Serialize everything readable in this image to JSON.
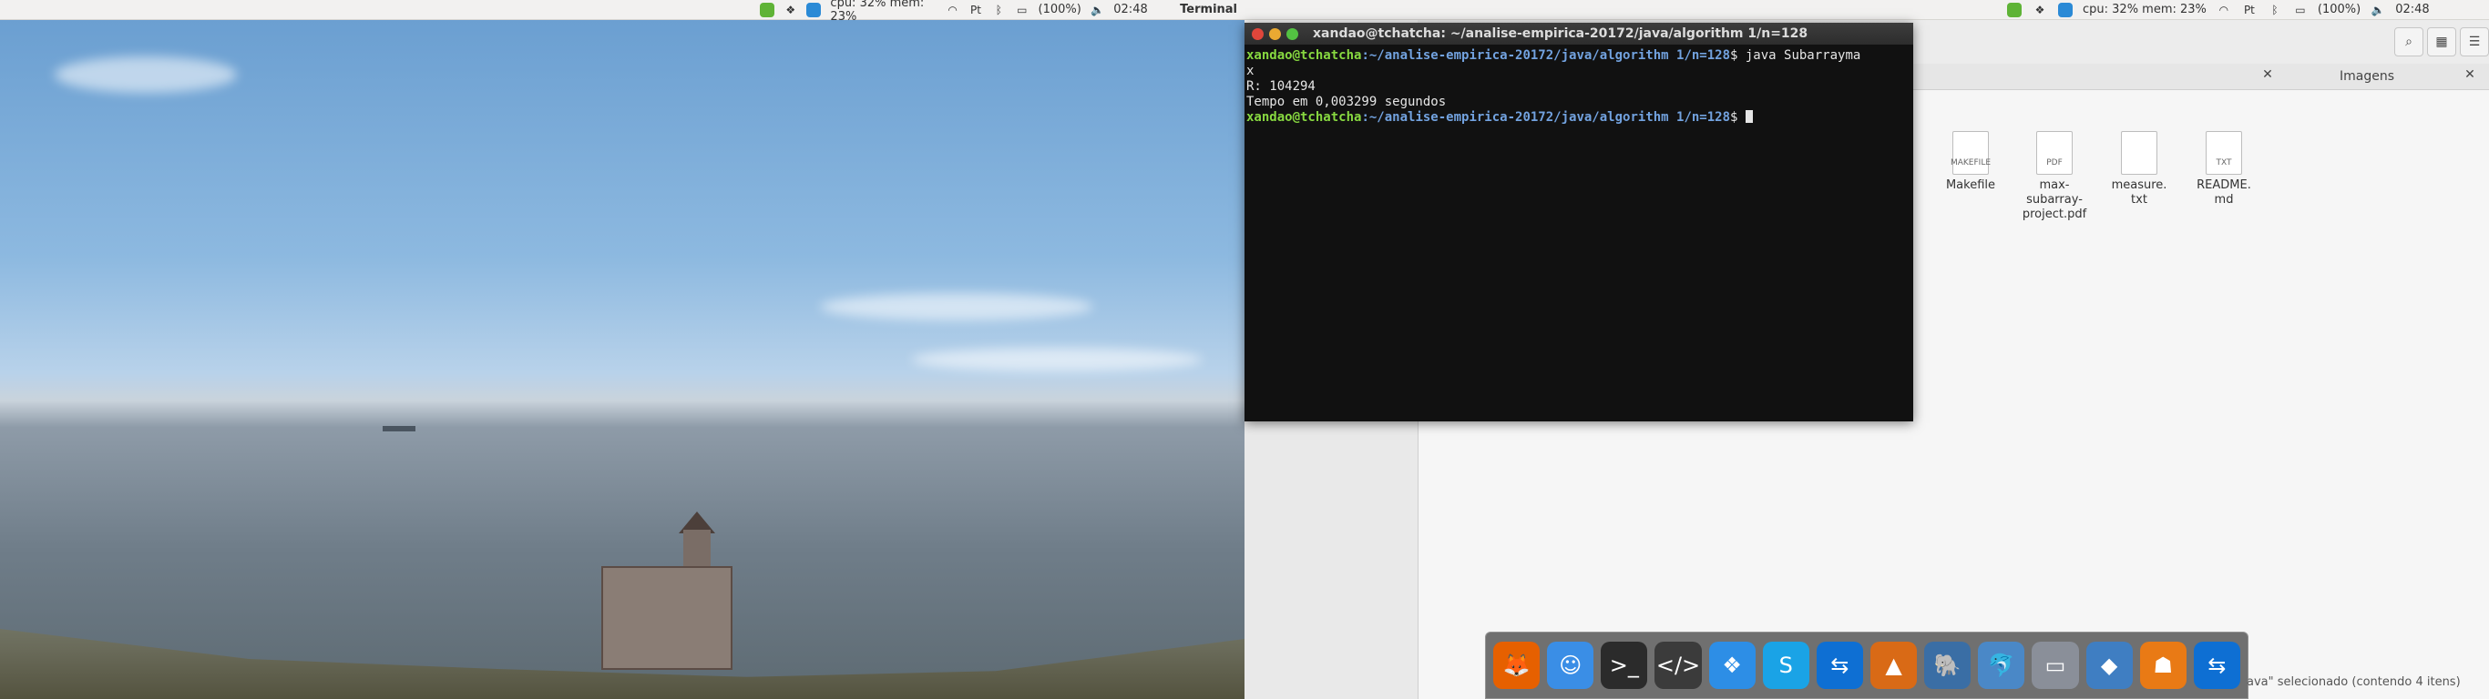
{
  "menubar": {
    "cpu_mem": "cpu: 32% mem: 23%",
    "lang": "Pt",
    "battery": "(100%)",
    "clock": "02:48",
    "app_name": "Terminal"
  },
  "terminal": {
    "title": "xandao@tchatcha: ~/analise-empirica-20172/java/algorithm 1/n=128",
    "lines": [
      {
        "user": "xandao@tchatcha",
        "path": ":~/analise-empirica-20172/java/algorithm 1/n=128",
        "cmd": "$ java Subarrayma"
      },
      {
        "text": "x"
      },
      {
        "text": "R: 104294"
      },
      {
        "text": "Tempo em 0,003299 segundos"
      },
      {
        "user": "xandao@tchatcha",
        "path": ":~/analise-empirica-20172/java/algorithm 1/n=128",
        "cmd": "$ "
      }
    ]
  },
  "files": {
    "tab_title": "Imagens",
    "items": [
      {
        "name": "Makefile",
        "icon": "MAKEFILE"
      },
      {
        "name": "max-\nsubarray-\nproject.pdf",
        "icon": "PDF"
      },
      {
        "name": "measure.\ntxt",
        "icon": ""
      },
      {
        "name": "README.\nmd",
        "icon": "TXT"
      }
    ],
    "status": "ava\" selecionado (contendo 4 itens)"
  },
  "dock": {
    "items": [
      {
        "icon": "firefox-icon",
        "glyph": "🦊",
        "color": "#e66000"
      },
      {
        "icon": "finder-icon",
        "glyph": "☺",
        "color": "#3a8ee6"
      },
      {
        "icon": "terminal-icon",
        "glyph": ">_",
        "color": "#2b2b2b"
      },
      {
        "icon": "code-editor-icon",
        "glyph": "</>",
        "color": "#3b3b3b"
      },
      {
        "icon": "dropbox-icon",
        "glyph": "❖",
        "color": "#2d8ee6"
      },
      {
        "icon": "skype-icon",
        "glyph": "S",
        "color": "#1aa3e6"
      },
      {
        "icon": "teamviewer-icon",
        "glyph": "⇆",
        "color": "#0e6fd3"
      },
      {
        "icon": "matlab-icon",
        "glyph": "▲",
        "color": "#d96a16"
      },
      {
        "icon": "postgres-icon",
        "glyph": "🐘",
        "color": "#3a6ea5"
      },
      {
        "icon": "mysql-icon",
        "glyph": "🐬",
        "color": "#4a88c7"
      },
      {
        "icon": "scanner-icon",
        "glyph": "▭",
        "color": "#8a8f99"
      },
      {
        "icon": "virtualbox-icon",
        "glyph": "◆",
        "color": "#3f7ec2"
      },
      {
        "icon": "network-icon",
        "glyph": "☗",
        "color": "#e97a15"
      },
      {
        "icon": "teamviewer-icon-2",
        "glyph": "⇆",
        "color": "#0e6fd3"
      }
    ]
  }
}
